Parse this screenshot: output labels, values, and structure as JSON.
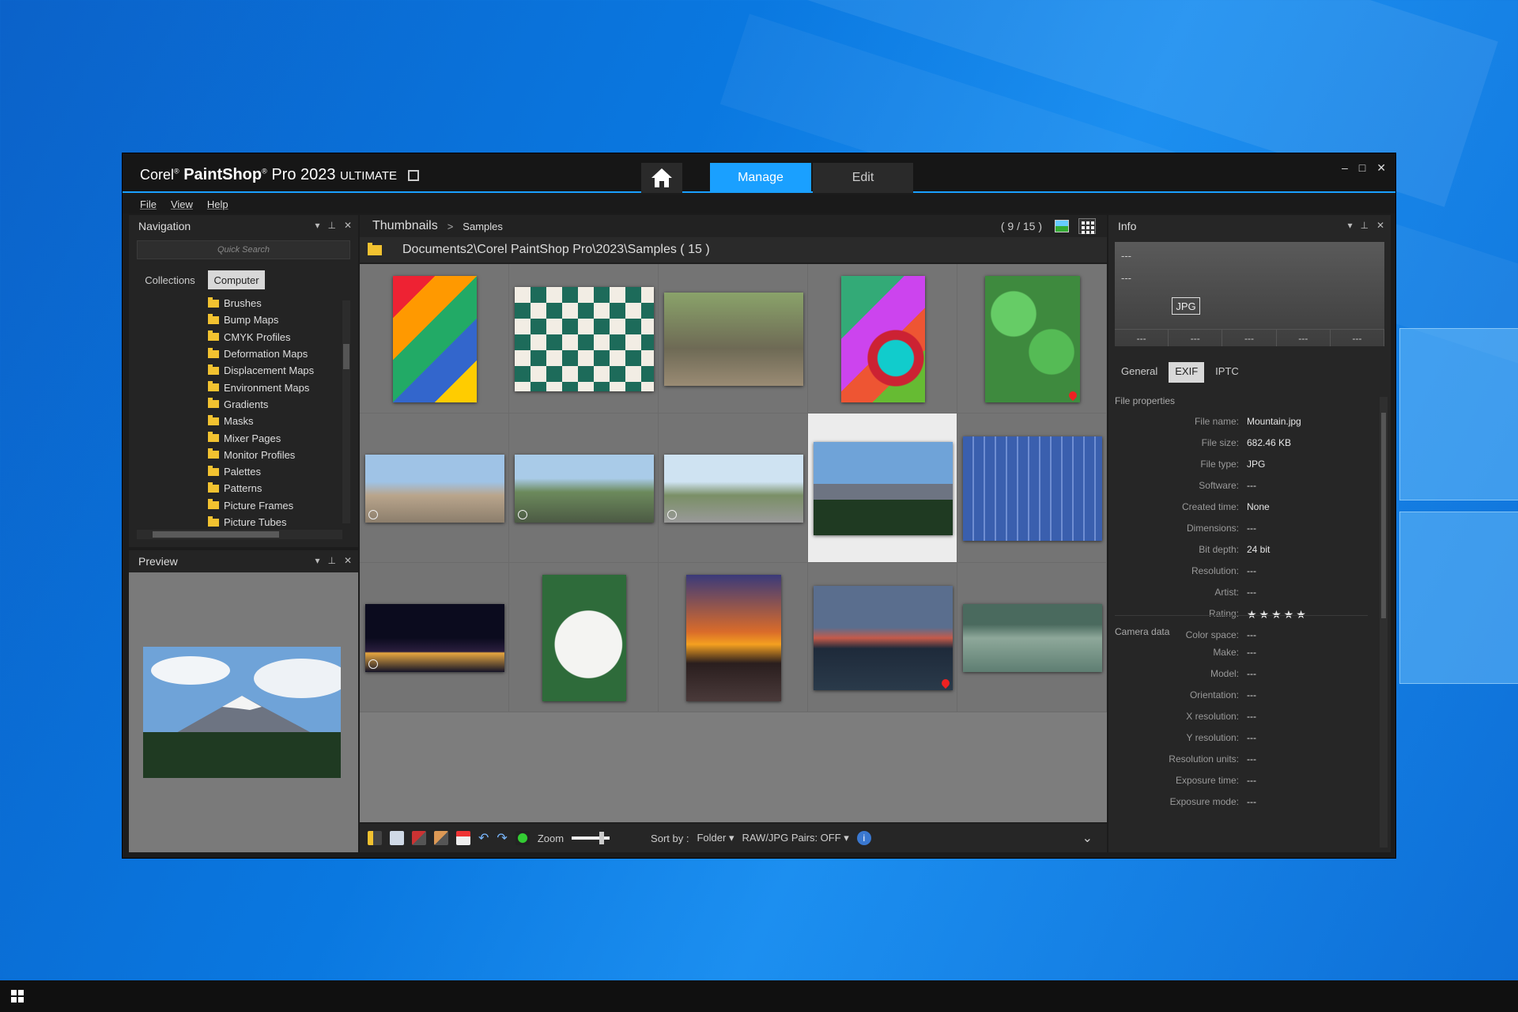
{
  "app": {
    "brand": "Corel",
    "product": "PaintShop",
    "product2": "Pro 2023",
    "edition": "ULTIMATE",
    "tabs": {
      "manage": "Manage",
      "edit": "Edit"
    },
    "window_controls": {
      "minimize": "–",
      "maximize": "□",
      "close": "✕"
    }
  },
  "menu": {
    "file": "File",
    "view": "View",
    "help": "Help"
  },
  "navigation": {
    "title": "Navigation",
    "search_placeholder": "Quick Search",
    "segments": {
      "collections": "Collections",
      "computer": "Computer"
    },
    "folders": [
      "Brushes",
      "Bump Maps",
      "CMYK Profiles",
      "Deformation Maps",
      "Displacement Maps",
      "Environment Maps",
      "Gradients",
      "Masks",
      "Mixer Pages",
      "Monitor Profiles",
      "Palettes",
      "Patterns",
      "Picture Frames",
      "Picture Tubes"
    ]
  },
  "preview_panel": {
    "title": "Preview"
  },
  "browser": {
    "title": "Thumbnails",
    "crumb_sep": ">",
    "crumb": "Samples",
    "count": "( 9 / 15 )",
    "path": "Documents2\\Corel PaintShop Pro\\2023\\Samples ( 15 )",
    "selected_index": 8
  },
  "toolbar": {
    "zoom_label": "Zoom",
    "zoom_level": 0.8,
    "sort_label": "Sort by :",
    "sort_value": "Folder",
    "raw_label": "RAW/JPG Pairs: OFF",
    "info_glyph": "i",
    "chevron": "⌄"
  },
  "info": {
    "title": "Info",
    "preview_dash_1": "---",
    "preview_dash_2": "---",
    "format_badge": "JPG",
    "cells": [
      "---",
      "---",
      "---",
      "---",
      "---"
    ],
    "tabs": {
      "general": "General",
      "exif": "EXIF",
      "iptc": "IPTC"
    },
    "file_section": "File properties",
    "file_props": [
      {
        "k": "File name:",
        "v": "Mountain.jpg"
      },
      {
        "k": "File size:",
        "v": "682.46 KB"
      },
      {
        "k": "File type:",
        "v": "JPG"
      },
      {
        "k": "Software:",
        "v": "---"
      },
      {
        "k": "Created time:",
        "v": "None"
      },
      {
        "k": "Dimensions:",
        "v": "---"
      },
      {
        "k": "Bit depth:",
        "v": "24 bit"
      },
      {
        "k": "Resolution:",
        "v": "---"
      },
      {
        "k": "Artist:",
        "v": "---"
      },
      {
        "k": "Rating:",
        "v": "★★★★★"
      },
      {
        "k": "Color space:",
        "v": "---"
      }
    ],
    "camera_section": "Camera data",
    "camera_props": [
      {
        "k": "Make:",
        "v": "---"
      },
      {
        "k": "Model:",
        "v": "---"
      },
      {
        "k": "Orientation:",
        "v": "---"
      },
      {
        "k": "X resolution:",
        "v": "---"
      },
      {
        "k": "Y resolution:",
        "v": "---"
      },
      {
        "k": "Resolution units:",
        "v": "---"
      },
      {
        "k": "Exposure time:",
        "v": "---"
      },
      {
        "k": "Exposure mode:",
        "v": "---"
      }
    ]
  },
  "colors": {
    "accent": "#1aa0ff",
    "folder": "#f2c230",
    "panel": "#242424",
    "grid": "#747474"
  },
  "icons": [
    "home-icon",
    "folder-icon",
    "thumbnail-view-icon",
    "details-view-icon",
    "rotate-left-icon",
    "rotate-right-icon",
    "info-icon",
    "pin-icon",
    "close-icon"
  ]
}
